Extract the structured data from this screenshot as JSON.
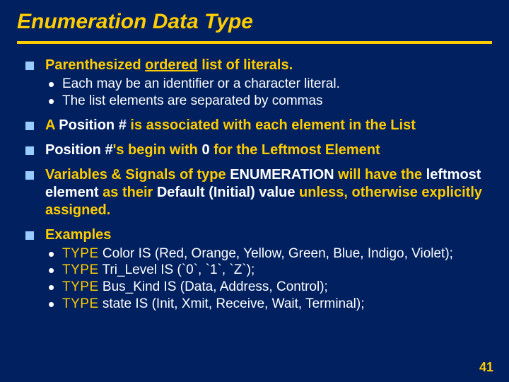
{
  "title": "Enumeration Data Type",
  "bullets": {
    "b1": {
      "pre": "Parenthesized ",
      "underlined": "ordered",
      "post": " list of literals.",
      "sub1": "Each may be an identifier or a character literal.",
      "sub2": "The list elements are separated by commas"
    },
    "b2": {
      "pre": "A ",
      "white": "Position #",
      "post": " is associated with each element in the List"
    },
    "b3": {
      "white1": "Position #",
      "mid": "'s begin with ",
      "white2": "0",
      "post": " for the Leftmost Element"
    },
    "b4": {
      "pre": "Variables & Signals of type ",
      "white1": "ENUMERATION",
      "mid1": " will have the ",
      "white2": "leftmost element",
      "mid2": " as their ",
      "white3": "Default (Initial) value",
      "post": " unless, otherwise explicitly assigned."
    },
    "b5": {
      "heading": "Examples",
      "ex1": {
        "kw": "TYPE",
        "rest": "   Color   IS   (Red, Orange, Yellow, Green, Blue, Indigo, Violet);"
      },
      "ex2": {
        "kw": "TYPE",
        "rest": "   Tri_Level   IS   (`0`, `1`, `Z`);"
      },
      "ex3": {
        "kw": "TYPE",
        "rest": "   Bus_Kind   IS   (Data, Address, Control);"
      },
      "ex4": {
        "kw": "TYPE",
        "rest": "   state   IS   (Init, Xmit, Receive, Wait, Terminal);"
      }
    }
  },
  "page_number": "41"
}
